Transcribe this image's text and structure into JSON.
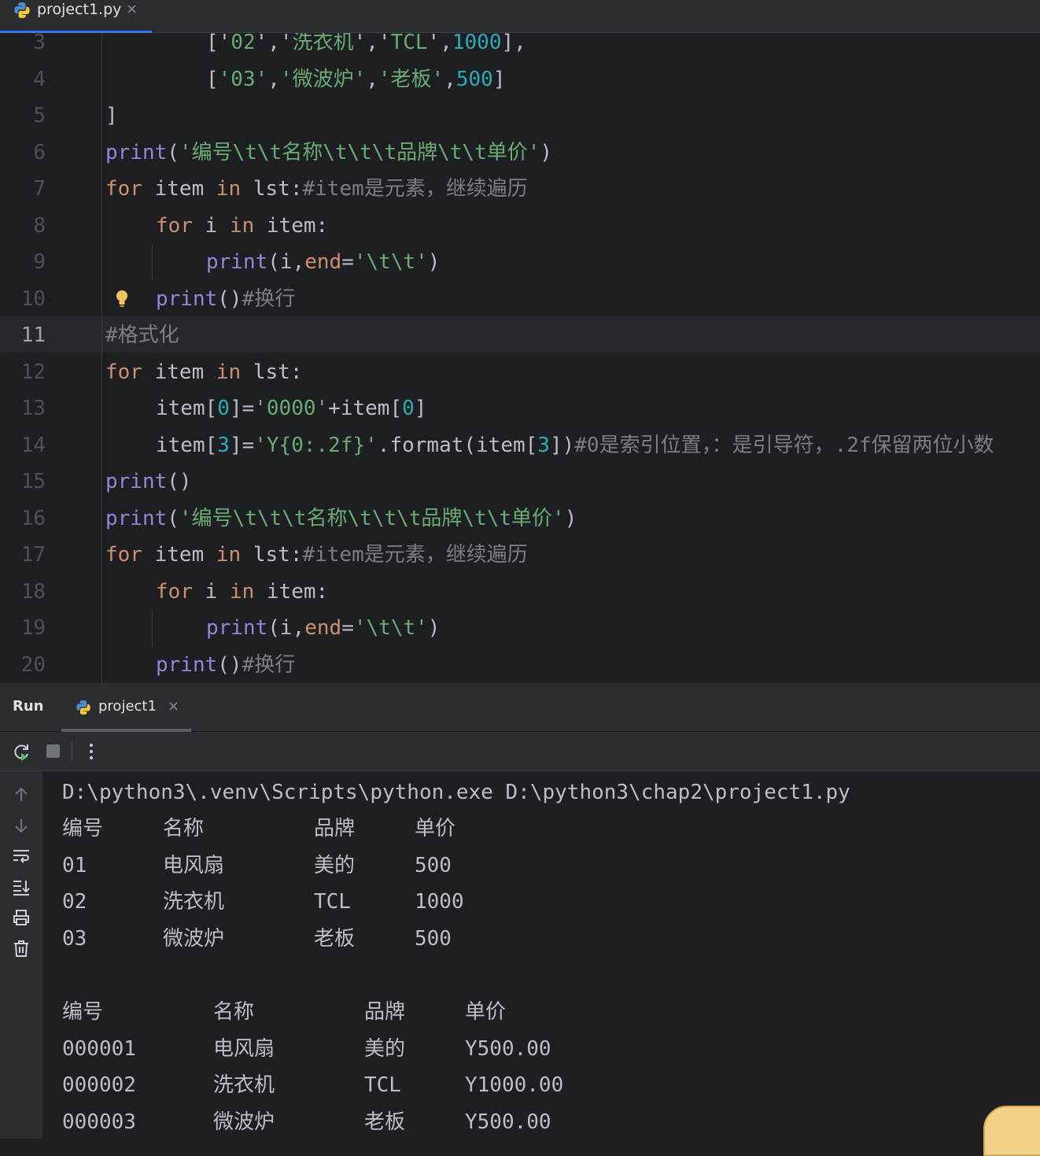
{
  "editor_tab": {
    "filename": "project1.py",
    "close": "×"
  },
  "editor": {
    "lines": [
      {
        "n": "3",
        "cur": false,
        "indent": 2,
        "tokens": [
          [
            "",
            "['"
          ],
          [
            "str",
            "02"
          ],
          [
            "",
            "','"
          ],
          [
            "str",
            "洗衣机"
          ],
          [
            "",
            "','"
          ],
          [
            "str",
            "TCL"
          ],
          [
            "",
            "',"
          ],
          [
            "num",
            "1000"
          ],
          [
            "",
            "],"
          ]
        ]
      },
      {
        "n": "4",
        "cur": false,
        "indent": 2,
        "tokens": [
          [
            "",
            "["
          ],
          [
            "str",
            "'03'"
          ],
          [
            "",
            ","
          ],
          [
            "str",
            "'微波炉'"
          ],
          [
            "",
            ","
          ],
          [
            "str",
            "'老板'"
          ],
          [
            "",
            ","
          ],
          [
            "num",
            "500"
          ],
          [
            "",
            "]"
          ]
        ]
      },
      {
        "n": "5",
        "cur": false,
        "indent": 0,
        "tokens": [
          [
            "",
            "]"
          ]
        ]
      },
      {
        "n": "6",
        "cur": false,
        "indent": 0,
        "tokens": [
          [
            "fn",
            "print"
          ],
          [
            "",
            "("
          ],
          [
            "str",
            "'编号\\t\\t名称\\t\\t\\t品牌\\t\\t单价'"
          ],
          [
            "",
            ")"
          ]
        ]
      },
      {
        "n": "7",
        "cur": false,
        "indent": 0,
        "tokens": [
          [
            "kw",
            "for"
          ],
          [
            "",
            " item "
          ],
          [
            "kw",
            "in"
          ],
          [
            "",
            " lst:"
          ],
          [
            "cmt",
            "#item是元素，继续遍历"
          ]
        ]
      },
      {
        "n": "8",
        "cur": false,
        "indent": 1,
        "tokens": [
          [
            "kw",
            "for"
          ],
          [
            "",
            " i "
          ],
          [
            "kw",
            "in"
          ],
          [
            "",
            " item:"
          ]
        ]
      },
      {
        "n": "9",
        "cur": false,
        "indent": 2,
        "tokens": [
          [
            "fn",
            "print"
          ],
          [
            "",
            "(i,"
          ],
          [
            "par",
            "end"
          ],
          [
            "",
            "="
          ],
          [
            "str",
            "'\\t\\t'"
          ],
          [
            "",
            ")"
          ]
        ]
      },
      {
        "n": "10",
        "cur": false,
        "indent": 1,
        "tokens": [
          [
            "fn",
            "print"
          ],
          [
            "",
            "()"
          ],
          [
            "cmt",
            "#换行"
          ]
        ]
      },
      {
        "n": "11",
        "cur": true,
        "indent": 0,
        "tokens": [
          [
            "cmt",
            "#格式化"
          ]
        ]
      },
      {
        "n": "12",
        "cur": false,
        "indent": 0,
        "tokens": [
          [
            "kw",
            "for"
          ],
          [
            "",
            " item "
          ],
          [
            "kw",
            "in"
          ],
          [
            "",
            " lst:"
          ]
        ]
      },
      {
        "n": "13",
        "cur": false,
        "indent": 1,
        "tokens": [
          [
            "",
            "item["
          ],
          [
            "num",
            "0"
          ],
          [
            "",
            "]="
          ],
          [
            "str",
            "'0000'"
          ],
          [
            "",
            "+item["
          ],
          [
            "num",
            "0"
          ],
          [
            "",
            "]"
          ]
        ]
      },
      {
        "n": "14",
        "cur": false,
        "indent": 1,
        "tokens": [
          [
            "",
            "item["
          ],
          [
            "num",
            "3"
          ],
          [
            "",
            "]="
          ],
          [
            "str",
            "'Y{0:.2f}'"
          ],
          [
            "",
            ".format(item["
          ],
          [
            "num",
            "3"
          ],
          [
            "",
            "])"
          ],
          [
            "cmt",
            "#0是索引位置，：是引导符，.2f保留两位小数"
          ]
        ]
      },
      {
        "n": "15",
        "cur": false,
        "indent": 0,
        "tokens": [
          [
            "fn",
            "print"
          ],
          [
            "",
            "()"
          ]
        ]
      },
      {
        "n": "16",
        "cur": false,
        "indent": 0,
        "tokens": [
          [
            "fn",
            "print"
          ],
          [
            "",
            "("
          ],
          [
            "str",
            "'编号\\t\\t\\t名称\\t\\t\\t品牌\\t\\t单价'"
          ],
          [
            "",
            ")"
          ]
        ]
      },
      {
        "n": "17",
        "cur": false,
        "indent": 0,
        "tokens": [
          [
            "kw",
            "for"
          ],
          [
            "",
            " item "
          ],
          [
            "kw",
            "in"
          ],
          [
            "",
            " lst:"
          ],
          [
            "cmt",
            "#item是元素，继续遍历"
          ]
        ]
      },
      {
        "n": "18",
        "cur": false,
        "indent": 1,
        "tokens": [
          [
            "kw",
            "for"
          ],
          [
            "",
            " i "
          ],
          [
            "kw",
            "in"
          ],
          [
            "",
            " item:"
          ]
        ]
      },
      {
        "n": "19",
        "cur": false,
        "indent": 2,
        "tokens": [
          [
            "fn",
            "print"
          ],
          [
            "",
            "(i,"
          ],
          [
            "par",
            "end"
          ],
          [
            "",
            "="
          ],
          [
            "str",
            "'\\t\\t'"
          ],
          [
            "",
            ")"
          ]
        ]
      },
      {
        "n": "20",
        "cur": false,
        "indent": 1,
        "tokens": [
          [
            "fn",
            "print"
          ],
          [
            "",
            "()"
          ],
          [
            "cmt",
            "#换行"
          ]
        ]
      }
    ]
  },
  "run": {
    "title": "Run",
    "tab_label": "project1",
    "close": "×",
    "command": "D:\\python3\\.venv\\Scripts\\python.exe D:\\python3\\chap2\\project1.py",
    "table1": [
      [
        "编号",
        "名称",
        "品牌",
        "单价"
      ],
      [
        "01",
        "电风扇",
        "美的",
        "500"
      ],
      [
        "02",
        "洗衣机",
        "TCL",
        "1000"
      ],
      [
        "03",
        "微波炉",
        "老板",
        "500"
      ]
    ],
    "table2": [
      [
        "编号",
        "名称",
        "品牌",
        "单价"
      ],
      [
        "000001",
        "电风扇",
        "美的",
        "Y500.00"
      ],
      [
        "000002",
        "洗衣机",
        "TCL",
        "Y1000.00"
      ],
      [
        "000003",
        "微波炉",
        "老板",
        "Y500.00"
      ]
    ]
  },
  "icons": {
    "editor_tab": "python-file-icon",
    "run_tab": "python-file-icon",
    "toolbar": [
      "rerun-icon",
      "stop-icon",
      "more-icon"
    ],
    "side": [
      "scroll-up-icon",
      "scroll-down-icon",
      "soft-wrap-icon",
      "scroll-to-end-icon",
      "print-icon",
      "clear-icon"
    ],
    "gutter": "intention-bulb-icon"
  },
  "colors": {
    "keyword": "#cf8e6d",
    "function": "#9386d6",
    "string": "#6aab73",
    "number": "#2aacb8",
    "comment": "#7a7e85",
    "accent": "#3574f0"
  }
}
